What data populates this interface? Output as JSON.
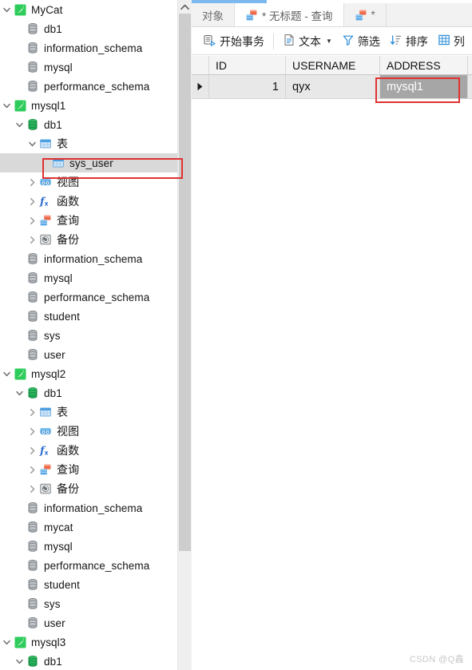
{
  "window": {
    "accent_color": "#7cb9f0",
    "selection_color": "#d9d9d9",
    "grid_selection_color": "#a6a6a6",
    "annotation_color": "#e03131"
  },
  "tabs": [
    {
      "label": "对象",
      "icon": "object-tab-icon",
      "active": false
    },
    {
      "label": "* 无标题 - 查询",
      "icon": "query-tab-icon",
      "active": true
    },
    {
      "label": "*",
      "icon": "query-tab-icon",
      "active": false
    }
  ],
  "toolbar": {
    "begin_transaction": "开始事务",
    "text": "文本",
    "filter": "筛选",
    "sort": "排序",
    "columns": "列"
  },
  "grid": {
    "columns": [
      "ID",
      "USERNAME",
      "ADDRESS"
    ],
    "rows": [
      {
        "ID": "1",
        "USERNAME": "qyx",
        "ADDRESS": "mysql1",
        "selected_column": "ADDRESS"
      }
    ]
  },
  "tree": {
    "items": [
      {
        "label": "MyCat",
        "depth": 0,
        "twisty": "down",
        "icon": "connection-icon",
        "selected": false
      },
      {
        "label": "db1",
        "depth": 1,
        "twisty": "none",
        "icon": "database-icon",
        "selected": false
      },
      {
        "label": "information_schema",
        "depth": 1,
        "twisty": "none",
        "icon": "database-icon",
        "selected": false
      },
      {
        "label": "mysql",
        "depth": 1,
        "twisty": "none",
        "icon": "database-icon",
        "selected": false
      },
      {
        "label": "performance_schema",
        "depth": 1,
        "twisty": "none",
        "icon": "database-icon",
        "selected": false
      },
      {
        "label": "mysql1",
        "depth": 0,
        "twisty": "down",
        "icon": "connection-icon",
        "selected": false
      },
      {
        "label": "db1",
        "depth": 1,
        "twisty": "down",
        "icon": "database-open-icon",
        "selected": false
      },
      {
        "label": "表",
        "depth": 2,
        "twisty": "down",
        "icon": "table-folder-icon",
        "selected": false
      },
      {
        "label": "sys_user",
        "depth": 3,
        "twisty": "none",
        "icon": "table-icon",
        "selected": true
      },
      {
        "label": "视图",
        "depth": 2,
        "twisty": "right",
        "icon": "view-icon",
        "selected": false
      },
      {
        "label": "函数",
        "depth": 2,
        "twisty": "right",
        "icon": "function-icon",
        "selected": false
      },
      {
        "label": "查询",
        "depth": 2,
        "twisty": "right",
        "icon": "query-icon",
        "selected": false
      },
      {
        "label": "备份",
        "depth": 2,
        "twisty": "right",
        "icon": "backup-icon",
        "selected": false
      },
      {
        "label": "information_schema",
        "depth": 1,
        "twisty": "none",
        "icon": "database-icon",
        "selected": false
      },
      {
        "label": "mysql",
        "depth": 1,
        "twisty": "none",
        "icon": "database-icon",
        "selected": false
      },
      {
        "label": "performance_schema",
        "depth": 1,
        "twisty": "none",
        "icon": "database-icon",
        "selected": false
      },
      {
        "label": "student",
        "depth": 1,
        "twisty": "none",
        "icon": "database-icon",
        "selected": false
      },
      {
        "label": "sys",
        "depth": 1,
        "twisty": "none",
        "icon": "database-icon",
        "selected": false
      },
      {
        "label": "user",
        "depth": 1,
        "twisty": "none",
        "icon": "database-icon",
        "selected": false
      },
      {
        "label": "mysql2",
        "depth": 0,
        "twisty": "down",
        "icon": "connection-icon",
        "selected": false
      },
      {
        "label": "db1",
        "depth": 1,
        "twisty": "down",
        "icon": "database-open-icon",
        "selected": false
      },
      {
        "label": "表",
        "depth": 2,
        "twisty": "right",
        "icon": "table-folder-icon",
        "selected": false
      },
      {
        "label": "视图",
        "depth": 2,
        "twisty": "right",
        "icon": "view-icon",
        "selected": false
      },
      {
        "label": "函数",
        "depth": 2,
        "twisty": "right",
        "icon": "function-icon",
        "selected": false
      },
      {
        "label": "查询",
        "depth": 2,
        "twisty": "right",
        "icon": "query-icon",
        "selected": false
      },
      {
        "label": "备份",
        "depth": 2,
        "twisty": "right",
        "icon": "backup-icon",
        "selected": false
      },
      {
        "label": "information_schema",
        "depth": 1,
        "twisty": "none",
        "icon": "database-icon",
        "selected": false
      },
      {
        "label": "mycat",
        "depth": 1,
        "twisty": "none",
        "icon": "database-icon",
        "selected": false
      },
      {
        "label": "mysql",
        "depth": 1,
        "twisty": "none",
        "icon": "database-icon",
        "selected": false
      },
      {
        "label": "performance_schema",
        "depth": 1,
        "twisty": "none",
        "icon": "database-icon",
        "selected": false
      },
      {
        "label": "student",
        "depth": 1,
        "twisty": "none",
        "icon": "database-icon",
        "selected": false
      },
      {
        "label": "sys",
        "depth": 1,
        "twisty": "none",
        "icon": "database-icon",
        "selected": false
      },
      {
        "label": "user",
        "depth": 1,
        "twisty": "none",
        "icon": "database-icon",
        "selected": false
      },
      {
        "label": "mysql3",
        "depth": 0,
        "twisty": "down",
        "icon": "connection-icon",
        "selected": false
      },
      {
        "label": "db1",
        "depth": 1,
        "twisty": "down",
        "icon": "database-open-icon",
        "selected": false
      }
    ]
  },
  "watermark": "CSDN @Q鑫"
}
